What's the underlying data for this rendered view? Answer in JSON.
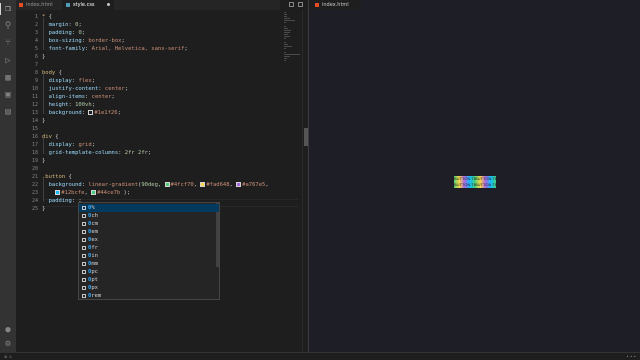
{
  "colors": {
    "editor_bg": "#1e1e1e",
    "preview_bg": "#1e1f26",
    "selector": "#d7ba7d",
    "property": "#9cdcfe",
    "value": "#ce9178",
    "number": "#b5cea8",
    "suggest_highlight": "#2aaaff",
    "gradient": [
      "#4fcf70",
      "#fad648",
      "#a767e5",
      "#12bcfe",
      "#44ce7b"
    ]
  },
  "activitybar": {
    "icons": [
      "files-icon",
      "search-icon",
      "source-control-icon",
      "run-debug-icon",
      "extensions-icon",
      "remote-explorer-icon",
      "testing-icon"
    ]
  },
  "tabs": [
    {
      "label": "index.html",
      "kind": "html"
    },
    {
      "label": "style.css",
      "kind": "css",
      "active": true,
      "dirty": true
    }
  ],
  "preview": {
    "tab_label": "index.html",
    "buttons": [
      "BUTTON TEXT",
      "BUTTON TEXT",
      "BUTTON TEXT",
      "BUTTON TEXT"
    ]
  },
  "editor": {
    "line_numbers": [
      "1",
      "2",
      "3",
      "4",
      "5",
      "6",
      "7",
      "8",
      "9",
      "10",
      "11",
      "12",
      "13",
      "14",
      "15",
      "16",
      "17",
      "18",
      "19",
      "20",
      "21",
      "22",
      "23",
      "24",
      "25"
    ],
    "lines": [
      [
        {
          "t": "* ",
          "c": "sel"
        },
        {
          "t": "{",
          "c": "pun"
        }
      ],
      [
        {
          "t": "  margin",
          "c": "prop"
        },
        {
          "t": ": ",
          "c": "pun"
        },
        {
          "t": "0",
          "c": "num"
        },
        {
          "t": ";",
          "c": "pun"
        }
      ],
      [
        {
          "t": "  padding",
          "c": "prop"
        },
        {
          "t": ": ",
          "c": "pun"
        },
        {
          "t": "0",
          "c": "num"
        },
        {
          "t": ";",
          "c": "pun"
        }
      ],
      [
        {
          "t": "  box-sizing",
          "c": "prop"
        },
        {
          "t": ": ",
          "c": "pun"
        },
        {
          "t": "border-box",
          "c": "val"
        },
        {
          "t": ";",
          "c": "pun"
        }
      ],
      [
        {
          "t": "  font-family",
          "c": "prop"
        },
        {
          "t": ": ",
          "c": "pun"
        },
        {
          "t": "Arial, Helvetica, sans-serif",
          "c": "val"
        },
        {
          "t": ";",
          "c": "pun"
        }
      ],
      [
        {
          "t": "}",
          "c": "pun"
        }
      ],
      [],
      [
        {
          "t": "body ",
          "c": "sel"
        },
        {
          "t": "{",
          "c": "pun"
        }
      ],
      [
        {
          "t": "  display",
          "c": "prop"
        },
        {
          "t": ": ",
          "c": "pun"
        },
        {
          "t": "flex",
          "c": "val"
        },
        {
          "t": ";",
          "c": "pun"
        }
      ],
      [
        {
          "t": "  justify-content",
          "c": "prop"
        },
        {
          "t": ": ",
          "c": "pun"
        },
        {
          "t": "center",
          "c": "val"
        },
        {
          "t": ";",
          "c": "pun"
        }
      ],
      [
        {
          "t": "  align-items",
          "c": "prop"
        },
        {
          "t": ": ",
          "c": "pun"
        },
        {
          "t": "center",
          "c": "val"
        },
        {
          "t": ";",
          "c": "pun"
        }
      ],
      [
        {
          "t": "  height",
          "c": "prop"
        },
        {
          "t": ": ",
          "c": "pun"
        },
        {
          "t": "100vh",
          "c": "num"
        },
        {
          "t": ";",
          "c": "pun"
        }
      ],
      [
        {
          "t": "  background",
          "c": "prop"
        },
        {
          "t": ": ",
          "c": "pun"
        },
        {
          "sw": "#1e1f26"
        },
        {
          "t": "#1e1f26",
          "c": "val"
        },
        {
          "t": ";",
          "c": "pun"
        }
      ],
      [
        {
          "t": "}",
          "c": "pun"
        }
      ],
      [],
      [
        {
          "t": "div ",
          "c": "sel"
        },
        {
          "t": "{",
          "c": "pun"
        }
      ],
      [
        {
          "t": "  display",
          "c": "prop"
        },
        {
          "t": ": ",
          "c": "pun"
        },
        {
          "t": "grid",
          "c": "val"
        },
        {
          "t": ";",
          "c": "pun"
        }
      ],
      [
        {
          "t": "  grid-template-columns",
          "c": "prop"
        },
        {
          "t": ": ",
          "c": "pun"
        },
        {
          "t": "2fr 2fr",
          "c": "num"
        },
        {
          "t": ";",
          "c": "pun"
        }
      ],
      [
        {
          "t": "}",
          "c": "pun"
        }
      ],
      [],
      [
        {
          "t": ".button ",
          "c": "sel"
        },
        {
          "t": "{",
          "c": "pun"
        }
      ],
      [
        {
          "t": "  background",
          "c": "prop"
        },
        {
          "t": ": ",
          "c": "pun"
        },
        {
          "t": "linear-gradient",
          "c": "val"
        },
        {
          "t": "(",
          "c": "pun"
        },
        {
          "t": "90deg",
          "c": "num"
        },
        {
          "t": ", ",
          "c": "pun"
        },
        {
          "sw": "#4fcf70"
        },
        {
          "t": "#4fcf70",
          "c": "val"
        },
        {
          "t": ", ",
          "c": "pun"
        },
        {
          "sw": "#fad648"
        },
        {
          "t": "#fad648",
          "c": "val"
        },
        {
          "t": ", ",
          "c": "pun"
        },
        {
          "sw": "#a767e5"
        },
        {
          "t": "#a767e5",
          "c": "val"
        },
        {
          "t": ",",
          "c": "pun"
        }
      ],
      [
        {
          "t": "    ",
          "c": "pun"
        },
        {
          "sw": "#12bcfe"
        },
        {
          "t": "#12bcfe",
          "c": "val"
        },
        {
          "t": ", ",
          "c": "pun"
        },
        {
          "sw": "#44ce7b"
        },
        {
          "t": "#44ce7b",
          "c": "val"
        },
        {
          "t": " );",
          "c": "pun"
        }
      ],
      [
        {
          "t": "  padding",
          "c": "prop"
        },
        {
          "t": ": ;",
          "c": "pun"
        }
      ],
      [
        {
          "t": "}",
          "c": "pun"
        }
      ]
    ]
  },
  "suggest": {
    "items": [
      "0%",
      "0ch",
      "0cm",
      "0em",
      "0ex",
      "0fr",
      "0in",
      "0mm",
      "0pc",
      "0pt",
      "0px",
      "0rem"
    ]
  }
}
